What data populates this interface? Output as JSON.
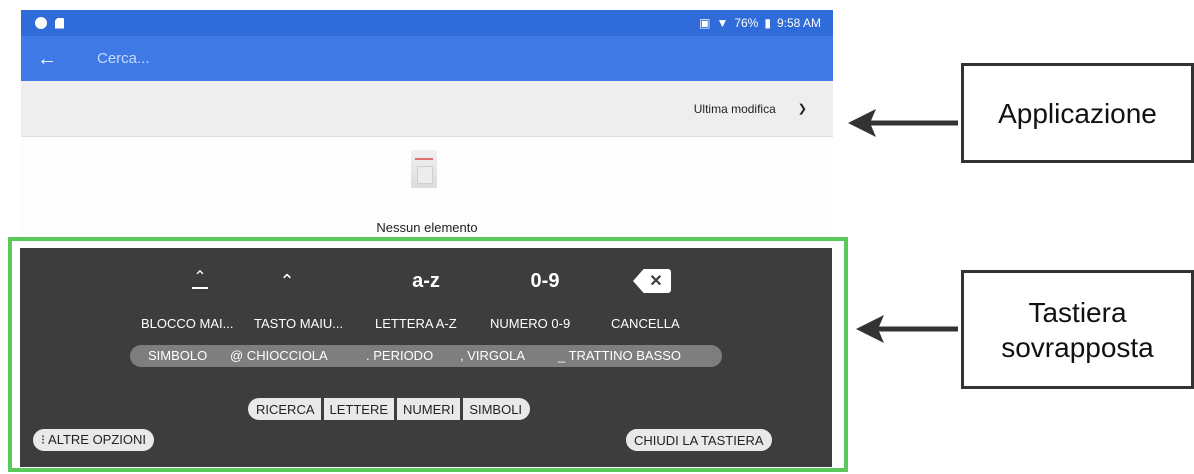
{
  "statusbar": {
    "battery": "76%",
    "time": "9:58 AM"
  },
  "toolbar": {
    "search_placeholder": "Cerca..."
  },
  "sort": {
    "label": "Ultima modifica"
  },
  "empty_state": {
    "text": "Nessun elemento"
  },
  "keyboard": {
    "icons": {
      "az": "a-z",
      "num": "0-9"
    },
    "labels": [
      "BLOCCO MAI...",
      "TASTO MAIU...",
      "LETTERA A-Z",
      "NUMERO 0-9",
      "CANCELLA"
    ],
    "symbols": [
      "SIMBOLO",
      "@ CHIOCCIOLA",
      ". PERIODO",
      ", VIRGOLA",
      "_ TRATTINO BASSO"
    ],
    "modes": [
      "RICERCA",
      "LETTERE",
      "NUMERI",
      "SIMBOLI"
    ],
    "more_options": "⁝ ALTRE OPZIONI",
    "close": "CHIUDI LA TASTIERA"
  },
  "callouts": {
    "app": "Applicazione",
    "keyboard_line1": "Tastiera",
    "keyboard_line2": "sovrapposta"
  },
  "colors": {
    "statusbar": "#2f6bd9",
    "toolbar": "#3f79e6",
    "keyboard_bg": "#3d3d3d",
    "overlay_border": "#5ac85a"
  }
}
